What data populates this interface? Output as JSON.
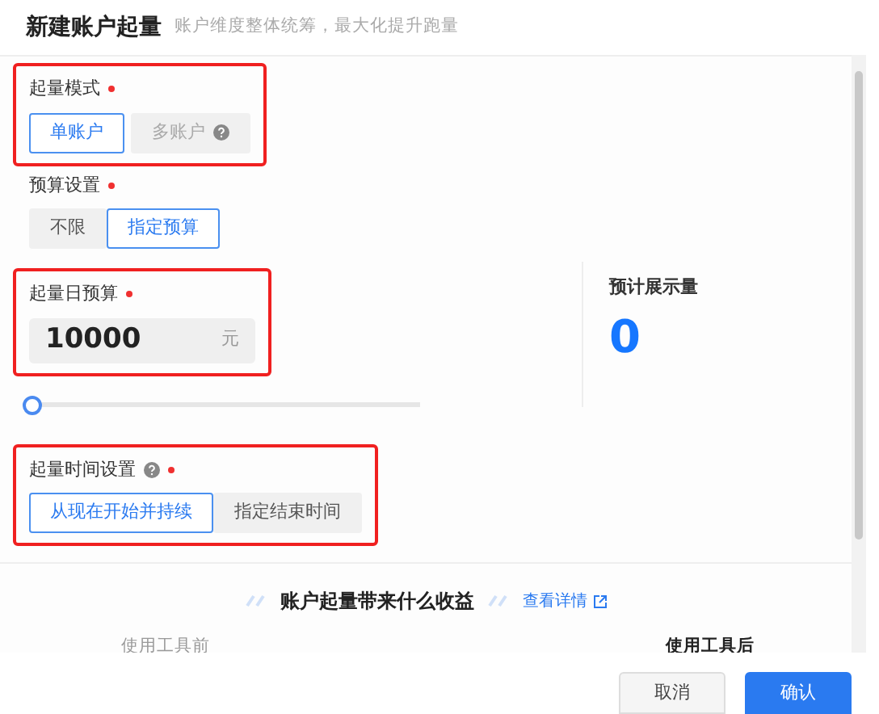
{
  "header": {
    "title": "新建账户起量",
    "subtitle": "账户维度整体统筹，最大化提升跑量"
  },
  "mode": {
    "label": "起量模式",
    "required": true,
    "highlighted": true,
    "options": [
      {
        "label": "单账户",
        "selected": true,
        "help": false
      },
      {
        "label": "多账户",
        "selected": false,
        "help": true
      }
    ]
  },
  "budget_setting": {
    "label": "预算设置",
    "required": true,
    "highlighted": false,
    "options": [
      {
        "label": "不限",
        "selected": false
      },
      {
        "label": "指定预算",
        "selected": true
      }
    ]
  },
  "daily_budget": {
    "label": "起量日预算",
    "required": true,
    "highlighted": true,
    "value": "10000",
    "unit": "元",
    "slider": {
      "level": 0
    }
  },
  "estimate": {
    "label": "预计展示量",
    "value": "0"
  },
  "time_setting": {
    "label": "起量时间设置",
    "help": true,
    "required": true,
    "highlighted": true,
    "options": [
      {
        "label": "从现在开始并持续",
        "selected": true
      },
      {
        "label": "指定结束时间",
        "selected": false
      }
    ]
  },
  "benefits": {
    "title": "账户起量带来什么收益",
    "link": "查看详情",
    "before": "使用工具前",
    "after": "使用工具后"
  },
  "footer": {
    "buttons": [
      {
        "label": "取消",
        "kind": "secondary"
      },
      {
        "label": "确认",
        "kind": "primary"
      }
    ]
  }
}
